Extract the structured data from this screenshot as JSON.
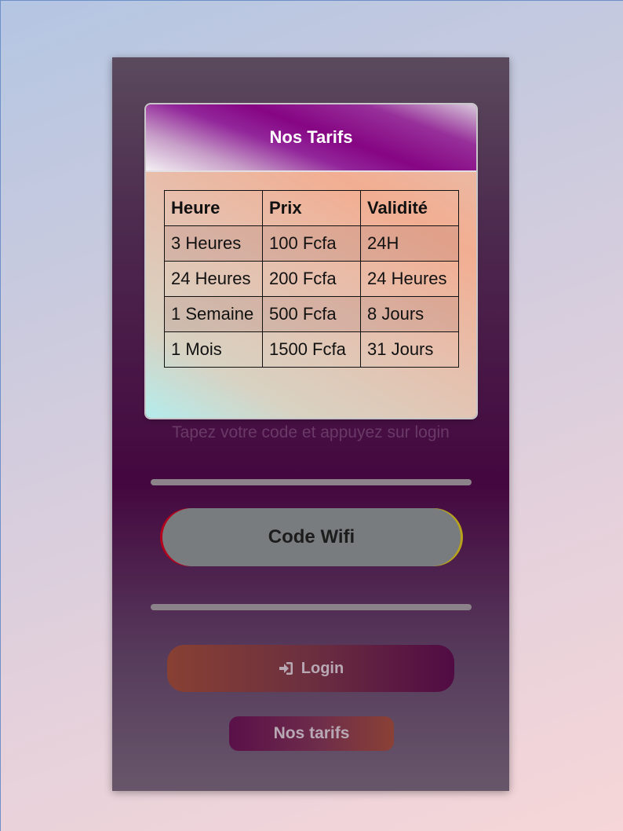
{
  "card": {
    "title": "Nos Tarifs",
    "table": {
      "headers": [
        "Heure",
        "Prix",
        "Validité"
      ],
      "rows": [
        [
          "3 Heures",
          "100 Fcfa",
          "24H"
        ],
        [
          "24 Heures",
          "200 Fcfa",
          "24 Heures"
        ],
        [
          "1 Semaine",
          "500 Fcfa",
          "8 Jours"
        ],
        [
          "1 Mois",
          "1500 Fcfa",
          "31 Jours"
        ]
      ]
    }
  },
  "hint": "Tapez votre code et appuyez sur login",
  "code_input": {
    "placeholder": "Code Wifi"
  },
  "login_button": {
    "label": "Login",
    "icon": "sign-in-icon"
  },
  "tarifs_button": {
    "label": "Nos tarifs"
  },
  "colors": {
    "panel": "#44073f",
    "header_accent": "#860583",
    "input_bg": "#797c7e",
    "login_from": "#884033",
    "login_to": "#510b44"
  }
}
